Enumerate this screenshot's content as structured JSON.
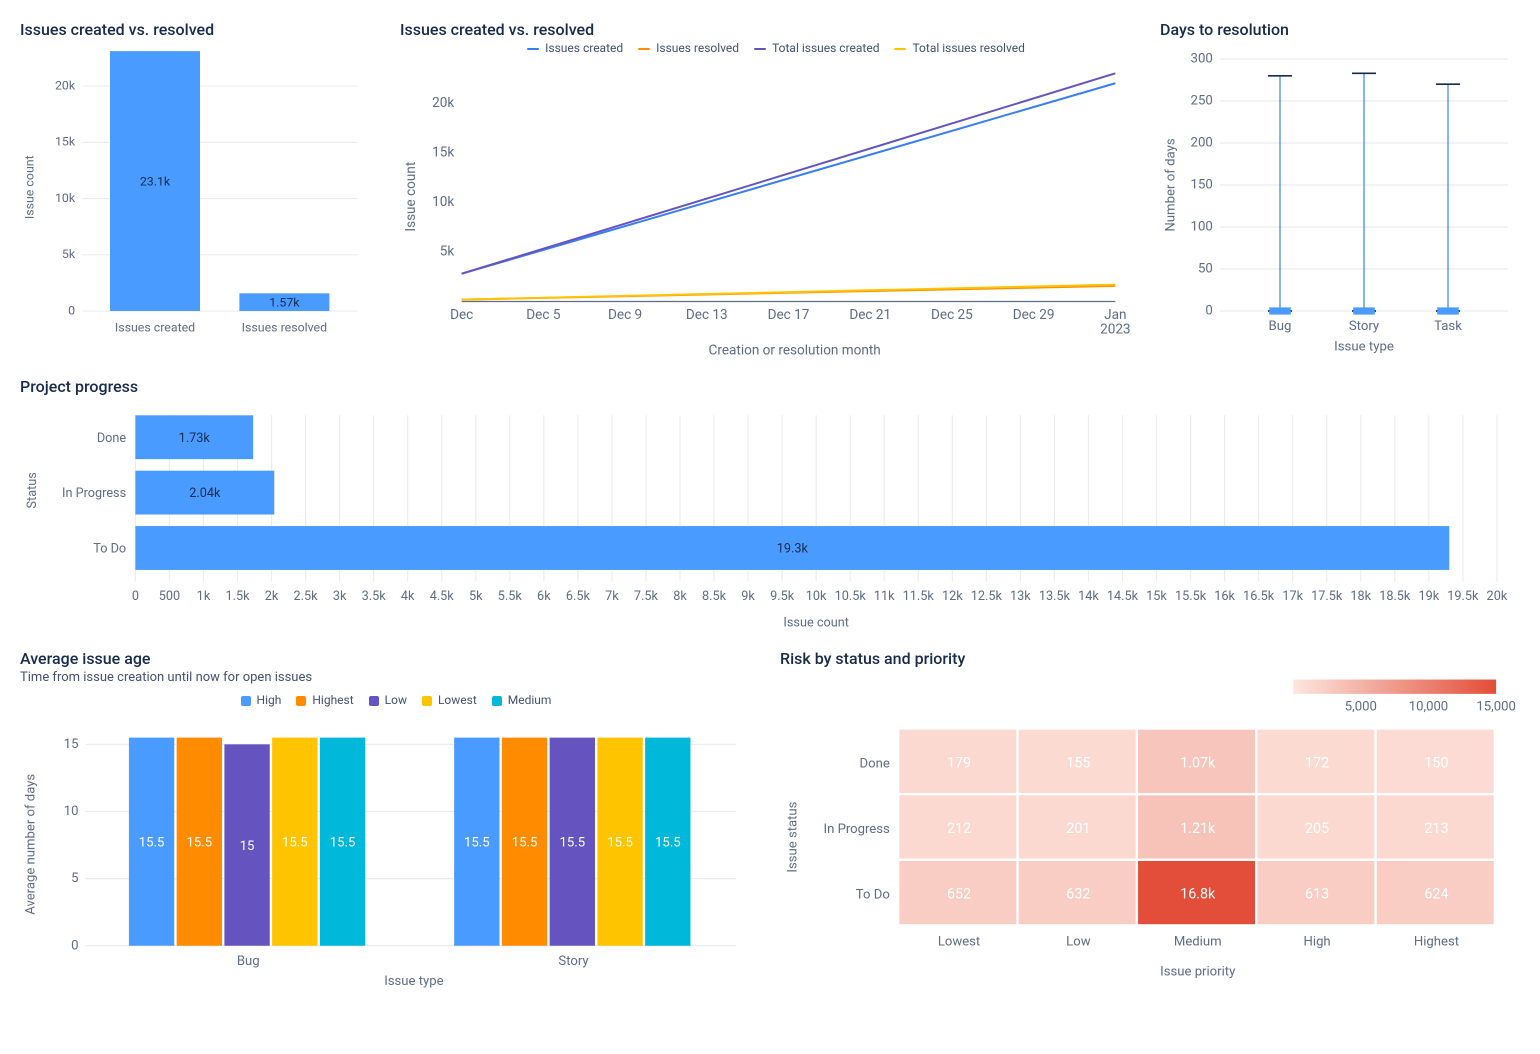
{
  "colors": {
    "blue": "#4a9bff",
    "dblue": "#387ef5",
    "orange": "#ff8b00",
    "purple": "#6554c0",
    "yellow": "#ffc400",
    "teal": "#00a3bf"
  },
  "barCR": {
    "title": "Issues created vs. resolved",
    "ylabel": "Issue count",
    "yticks": [
      "0",
      "5k",
      "10k",
      "15k",
      "20k"
    ],
    "labels": [
      "Issues created",
      "Issues resolved"
    ],
    "values": [
      23100,
      1570
    ],
    "display": [
      "23.1k",
      "1.57k"
    ]
  },
  "lineCR": {
    "title": "Issues created vs. resolved",
    "ylabel": "Issue count",
    "xlabel": "Creation or resolution month",
    "yticks": [
      "5k",
      "10k",
      "15k",
      "20k"
    ],
    "xticks": [
      "Dec",
      "Dec 5",
      "Dec 9",
      "Dec 13",
      "Dec 17",
      "Dec 21",
      "Dec 25",
      "Dec 29",
      "Jan 2023"
    ],
    "legend": [
      "Issues created",
      "Issues resolved",
      "Total issues created",
      "Total issues resolved"
    ],
    "series": {
      "issues_created": [
        2800,
        22000
      ],
      "issues_resolved": [
        190,
        1570
      ],
      "total_issues_created": [
        2800,
        23000
      ],
      "total_issues_resolved": [
        190,
        1700
      ]
    }
  },
  "days": {
    "title": "Days to resolution",
    "ylabel": "Number of days",
    "xlabel": "Issue type",
    "yticks": [
      "0",
      "50",
      "100",
      "150",
      "200",
      "250",
      "300"
    ],
    "cats": [
      "Bug",
      "Story",
      "Task"
    ],
    "ranges": [
      {
        "lo": 0,
        "hi": 280
      },
      {
        "lo": 0,
        "hi": 283
      },
      {
        "lo": 0,
        "hi": 270
      }
    ]
  },
  "progress": {
    "title": "Project progress",
    "ylabel": "Status",
    "xlabel": "Issue count",
    "xticks": [
      "0",
      "500",
      "1k",
      "1.5k",
      "2k",
      "2.5k",
      "3k",
      "3.5k",
      "4k",
      "4.5k",
      "5k",
      "5.5k",
      "6k",
      "6.5k",
      "7k",
      "7.5k",
      "8k",
      "8.5k",
      "9k",
      "9.5k",
      "10k",
      "10.5k",
      "11k",
      "11.5k",
      "12k",
      "12.5k",
      "13k",
      "13.5k",
      "14k",
      "14.5k",
      "15k",
      "15.5k",
      "16k",
      "16.5k",
      "17k",
      "17.5k",
      "18k",
      "18.5k",
      "19k",
      "19.5k",
      "20k"
    ],
    "cats": [
      "Done",
      "In Progress",
      "To Do"
    ],
    "values": [
      1730,
      2040,
      19300
    ],
    "display": [
      "1.73k",
      "2.04k",
      "19.3k"
    ]
  },
  "age": {
    "title": "Average issue age",
    "sub": "Time from issue creation until now for open issues",
    "ylabel": "Average number of days",
    "xlabel": "Issue type",
    "yticks": [
      "0",
      "5",
      "10",
      "15"
    ],
    "legend": [
      "High",
      "Highest",
      "Low",
      "Lowest",
      "Medium"
    ],
    "groups": [
      "Bug",
      "Story"
    ],
    "values": [
      [
        15.5,
        15.5,
        15,
        15.5,
        15.5
      ],
      [
        15.5,
        15.5,
        15.5,
        15.5,
        15.5
      ]
    ],
    "display": [
      [
        "15.5",
        "15.5",
        "15",
        "15.5",
        "15.5"
      ],
      [
        "15.5",
        "15.5",
        "15.5",
        "15.5",
        "15.5"
      ]
    ]
  },
  "heat": {
    "title": "Risk by status and priority",
    "ylabel": "Issue status",
    "xlabel": "Issue priority",
    "legendticks": [
      "5,000",
      "10,000",
      "15,000"
    ],
    "rows": [
      "Done",
      "In Progress",
      "To Do"
    ],
    "cols": [
      "Lowest",
      "Low",
      "Medium",
      "High",
      "Highest"
    ],
    "values": [
      [
        179,
        155,
        1070,
        172,
        150
      ],
      [
        212,
        201,
        1210,
        205,
        213
      ],
      [
        652,
        632,
        16800,
        613,
        624
      ]
    ],
    "display": [
      [
        "179",
        "155",
        "1.07k",
        "172",
        "150"
      ],
      [
        "212",
        "201",
        "1.21k",
        "205",
        "213"
      ],
      [
        "652",
        "632",
        "16.8k",
        "613",
        "624"
      ]
    ]
  },
  "chart_data": [
    {
      "type": "bar",
      "title": "Issues created vs. resolved",
      "ylabel": "Issue count",
      "categories": [
        "Issues created",
        "Issues resolved"
      ],
      "values": [
        23100,
        1570
      ],
      "ylim": [
        0,
        23000
      ]
    },
    {
      "type": "line",
      "title": "Issues created vs. resolved",
      "xlabel": "Creation or resolution month",
      "ylabel": "Issue count",
      "x": [
        "Dec",
        "Dec 5",
        "Dec 9",
        "Dec 13",
        "Dec 17",
        "Dec 21",
        "Dec 25",
        "Dec 29",
        "Jan 2023"
      ],
      "series": [
        {
          "name": "Issues created",
          "values": [
            2800,
            22000
          ],
          "only_endpoints": true
        },
        {
          "name": "Issues resolved",
          "values": [
            190,
            1570
          ],
          "only_endpoints": true
        },
        {
          "name": "Total issues created",
          "values": [
            2800,
            23000
          ],
          "only_endpoints": true
        },
        {
          "name": "Total issues resolved",
          "values": [
            190,
            1700
          ],
          "only_endpoints": true
        }
      ],
      "ylim": [
        0,
        23000
      ]
    },
    {
      "type": "bar",
      "title": "Days to resolution",
      "ylabel": "Number of days",
      "xlabel": "Issue type",
      "categories": [
        "Bug",
        "Story",
        "Task"
      ],
      "series": [
        {
          "name": "range_low",
          "values": [
            0,
            0,
            0
          ]
        },
        {
          "name": "range_high",
          "values": [
            280,
            283,
            270
          ]
        }
      ],
      "ylim": [
        0,
        300
      ]
    },
    {
      "type": "bar",
      "orientation": "horizontal",
      "title": "Project progress",
      "xlabel": "Issue count",
      "ylabel": "Status",
      "categories": [
        "Done",
        "In Progress",
        "To Do"
      ],
      "values": [
        1730,
        2040,
        19300
      ],
      "xlim": [
        0,
        20000
      ]
    },
    {
      "type": "bar",
      "title": "Average issue age",
      "subtitle": "Time from issue creation until now for open issues",
      "ylabel": "Average number of days",
      "xlabel": "Issue type",
      "categories": [
        "Bug",
        "Story"
      ],
      "series": [
        {
          "name": "High",
          "values": [
            15.5,
            15.5
          ]
        },
        {
          "name": "Highest",
          "values": [
            15.5,
            15.5
          ]
        },
        {
          "name": "Low",
          "values": [
            15,
            15.5
          ]
        },
        {
          "name": "Lowest",
          "values": [
            15.5,
            15.5
          ]
        },
        {
          "name": "Medium",
          "values": [
            15.5,
            15.5
          ]
        }
      ],
      "ylim": [
        0,
        16
      ]
    },
    {
      "type": "heatmap",
      "title": "Risk by status and priority",
      "xlabel": "Issue priority",
      "ylabel": "Issue status",
      "rows": [
        "Done",
        "In Progress",
        "To Do"
      ],
      "cols": [
        "Lowest",
        "Low",
        "Medium",
        "High",
        "Highest"
      ],
      "values": [
        [
          179,
          155,
          1070,
          172,
          150
        ],
        [
          212,
          201,
          1210,
          205,
          213
        ],
        [
          652,
          632,
          16800,
          613,
          624
        ]
      ]
    }
  ]
}
